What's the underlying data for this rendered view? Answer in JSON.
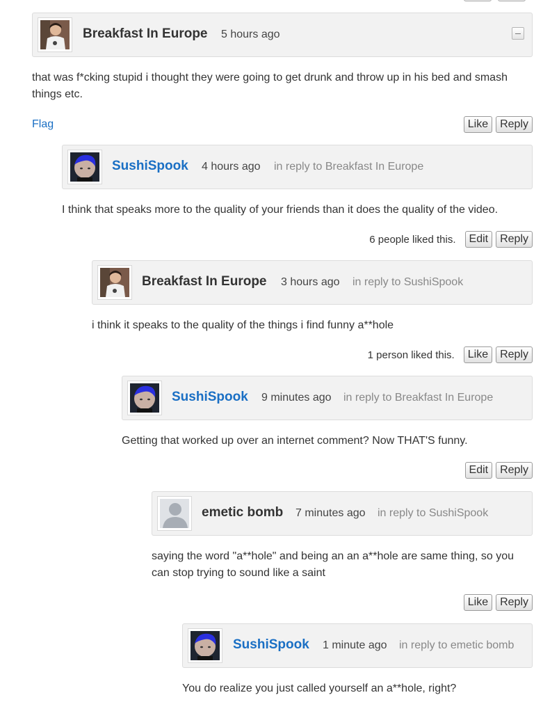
{
  "comments": [
    {
      "author": "Breakfast In Europe",
      "time": "5 hours ago",
      "reply_to": "",
      "text": "that was f*cking stupid i thought they were going to get drunk and throw up in his bed and smash things etc.",
      "flag": "Flag",
      "likes": "",
      "buttons": [
        "Like",
        "Reply"
      ],
      "avatar": "photo-avatar-breakfast"
    },
    {
      "author": "SushiSpook",
      "time": "4 hours ago",
      "reply_to": "in reply to Breakfast In Europe",
      "text": "I think that speaks more to the quality of your friends than it does the quality of the video.",
      "likes": "6 people liked this.",
      "buttons": [
        "Edit",
        "Reply"
      ],
      "avatar": "photo-avatar-sushi"
    },
    {
      "author": "Breakfast In Europe",
      "time": "3 hours ago",
      "reply_to": "in reply to SushiSpook",
      "text": "i think it speaks to the quality of the things i find funny a**hole",
      "likes": "1 person liked this.",
      "buttons": [
        "Like",
        "Reply"
      ],
      "avatar": "photo-avatar-breakfast"
    },
    {
      "author": "SushiSpook",
      "time": "9 minutes ago",
      "reply_to": "in reply to Breakfast In Europe",
      "text": "Getting that worked up over an internet comment? Now THAT'S funny.",
      "likes": "",
      "buttons": [
        "Edit",
        "Reply"
      ],
      "avatar": "photo-avatar-sushi"
    },
    {
      "author": "emetic bomb",
      "time": "7 minutes ago",
      "reply_to": "in reply to SushiSpook",
      "text": "saying the word \"a**hole\" and being an an a**hole are same thing, so you can stop trying to sound like a saint",
      "likes": "",
      "buttons": [
        "Like",
        "Reply"
      ],
      "avatar": "default-user-avatar"
    },
    {
      "author": "SushiSpook",
      "time": "1 minute ago",
      "reply_to": "in reply to emetic bomb",
      "text": "You do realize you just called yourself an a**hole, right?",
      "likes": "",
      "buttons": [],
      "avatar": "photo-avatar-sushi"
    }
  ],
  "colors": {
    "link": "#1a6fc4",
    "header_bg": "#f2f2f2",
    "muted": "#888888"
  }
}
